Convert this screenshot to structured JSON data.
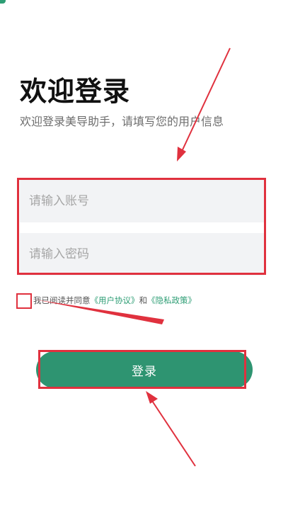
{
  "title": "欢迎登录",
  "subtitle": "欢迎登录美导助手，请填写您的用户信息",
  "form": {
    "account_placeholder": "请输入账号",
    "password_placeholder": "请输入密码"
  },
  "agreement": {
    "prefix": "我已阅读并同意",
    "user_agreement_link": "《用户协议》",
    "conjunction": "和",
    "privacy_link": "《隐私政策》"
  },
  "login_button": "登录",
  "colors": {
    "primary_green": "#2e9471",
    "link_green": "#2e9e75",
    "annotation_red": "#e0313e",
    "field_bg": "#f2f3f5"
  },
  "icons": [
    "annotation-arrow-icon"
  ]
}
